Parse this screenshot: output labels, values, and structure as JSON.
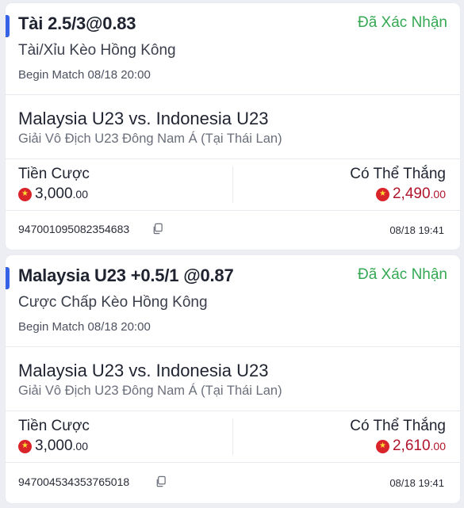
{
  "bets": [
    {
      "title_main": "Tài 2.5/3",
      "title_at": "@",
      "title_odds": "0.83",
      "status": "Đã Xác Nhận",
      "market": "Tài/Xỉu Kèo Hồng Kông",
      "begin": "Begin Match 08/18 20:00",
      "match": "Malaysia U23 vs. Indonesia U23",
      "league": "Giải Vô Địch U23 Đông Nam Á (Tại Thái Lan)",
      "stake_label": "Tiền Cược",
      "stake_main": "3,000",
      "stake_dec": ".00",
      "win_label": "Có Thể Thắng",
      "win_main": "2,490",
      "win_dec": ".00",
      "ticket_id": "947001095082354683",
      "time": "08/18 19:41"
    },
    {
      "title_main": "Malaysia U23 +0.5/1",
      "title_at": "@",
      "title_odds": "0.87",
      "status": "Đã Xác Nhận",
      "market": "Cược Chấp Kèo Hồng Kông",
      "begin": "Begin Match 08/18 20:00",
      "match": "Malaysia U23 vs. Indonesia U23",
      "league": "Giải Vô Địch U23 Đông Nam Á (Tại Thái Lan)",
      "stake_label": "Tiền Cược",
      "stake_main": "3,000",
      "stake_dec": ".00",
      "win_label": "Có Thể Thắng",
      "win_main": "2,610",
      "win_dec": ".00",
      "ticket_id": "947004534353765018",
      "time": "08/18 19:41"
    }
  ],
  "icons": {
    "currency": "vietnam-flag-coin-icon",
    "copy": "copy-icon"
  },
  "colors": {
    "accent": "#3562e6",
    "status": "#34a853",
    "win_amount": "#b0142b",
    "flag_red": "#d9242a",
    "flag_star": "#ffdd33"
  }
}
